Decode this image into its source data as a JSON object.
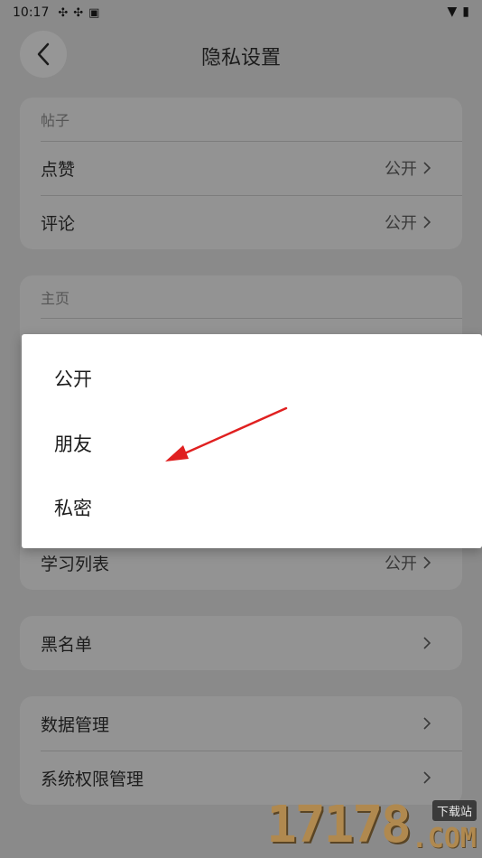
{
  "status": {
    "time": "10:17",
    "icons": [
      "sync-icon",
      "sync-icon",
      "a-icon"
    ],
    "right_icons": [
      "wifi-icon",
      "battery-icon"
    ]
  },
  "header": {
    "title": "隐私设置"
  },
  "cards": {
    "posts": {
      "section": "帖子",
      "rows": [
        {
          "label": "点赞",
          "value": "公开"
        },
        {
          "label": "评论",
          "value": "公开"
        }
      ]
    },
    "home": {
      "section": "主页",
      "rows": [
        {
          "label": "学习列表",
          "value": "公开"
        }
      ]
    },
    "blacklist": {
      "rows": [
        {
          "label": "黑名单"
        }
      ]
    },
    "data": {
      "rows": [
        {
          "label": "数据管理"
        },
        {
          "label": "系统权限管理"
        }
      ]
    }
  },
  "dialog": {
    "options": [
      "公开",
      "朋友",
      "私密"
    ]
  },
  "annotation": {
    "arrow_color": "#e02020"
  },
  "watermark": {
    "number": "17178",
    "cn": "下载站",
    "com": ".COM"
  }
}
